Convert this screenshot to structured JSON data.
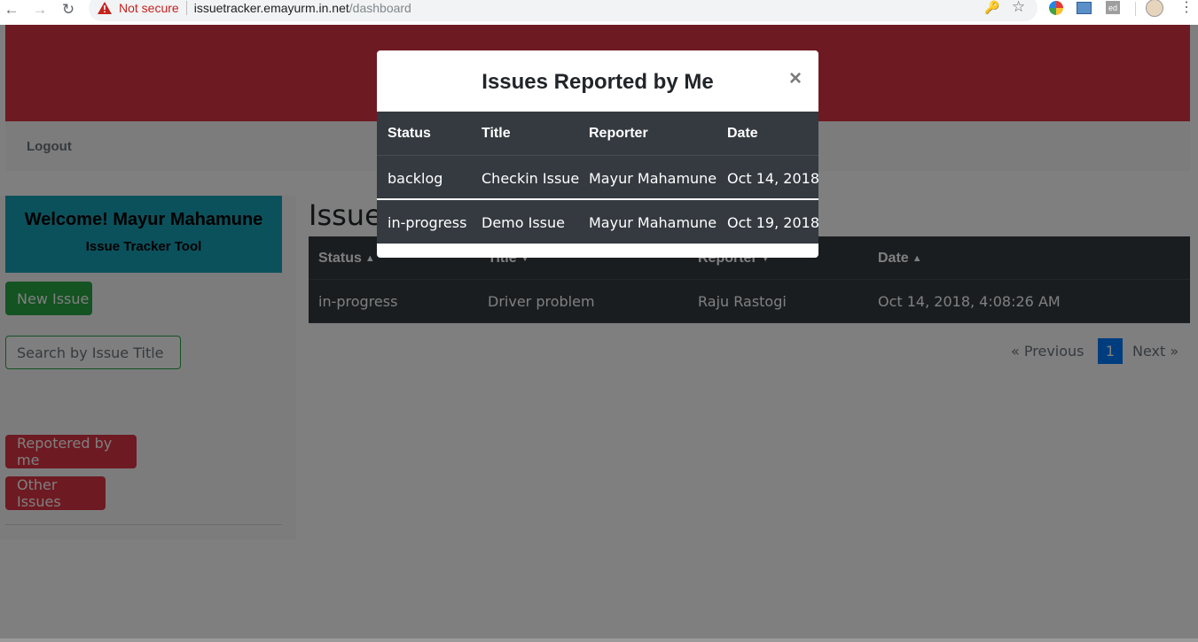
{
  "browser": {
    "security_label": "Not secure",
    "url_host": "issuetracker.emayurm.in.net",
    "url_path": "/dashboard",
    "ext3_label": "ed"
  },
  "navbar": {
    "logout_label": "Logout"
  },
  "sidebar": {
    "welcome_title": "Welcome! Mayur Mahamune",
    "welcome_subtitle": "Issue Tracker Tool",
    "new_issue_label": "New Issue",
    "search_placeholder": "Search by Issue Title",
    "reported_by_me_label": "Repotered by me",
    "other_issues_label": "Other Issues"
  },
  "main": {
    "heading": "Issues",
    "table": {
      "headers": [
        "Status",
        "Title",
        "Reporter",
        "Date"
      ],
      "rows": [
        [
          "in-progress",
          "Driver problem",
          "Raju Rastogi",
          "Oct 14, 2018, 4:08:26 AM"
        ]
      ]
    },
    "pagination": {
      "previous": "«  Previous",
      "current": "1",
      "next": "Next  »"
    }
  },
  "modal": {
    "title": "Issues Reported by Me",
    "close": "×",
    "headers": [
      "Status",
      "Title",
      "Reporter",
      "Date"
    ],
    "rows": [
      [
        "backlog",
        "Checkin Issue",
        "Mayur Mahamune",
        "Oct 14, 2018"
      ],
      [
        "in-progress",
        "Demo Issue",
        "Mayur Mahamune",
        "Oct 19, 2018"
      ]
    ]
  },
  "colors": {
    "banner": "#dc3545",
    "success": "#28a745",
    "info": "#17a2b8",
    "dark": "#343a40",
    "primary": "#007bff"
  }
}
